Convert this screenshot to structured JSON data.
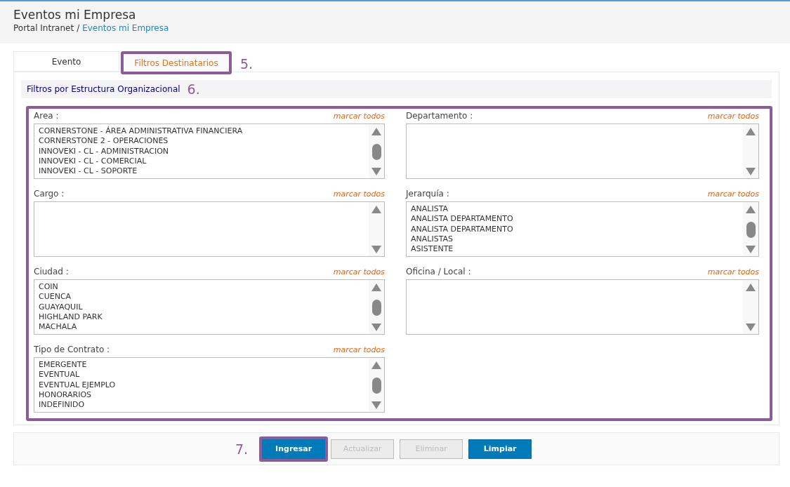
{
  "header": {
    "title": "Eventos mi Empresa",
    "breadcrumb_separator": "/",
    "breadcrumb": [
      {
        "label": "Portal Intranet",
        "current": false
      },
      {
        "label": "Eventos mi Empresa",
        "current": true
      }
    ]
  },
  "tabs": [
    {
      "label": "Evento",
      "selected": false,
      "highlighted": false
    },
    {
      "label": "Filtros Destinatarios",
      "selected": true,
      "highlighted": true
    }
  ],
  "tabs_annotation": "5.",
  "section": {
    "title": "Filtros por Estructura Organizacional",
    "annotation": "6.",
    "highlighted": true
  },
  "filters": [
    {
      "label": "Area :",
      "link": "marcar todos",
      "items": [
        "CORNERSTONE - ÁREA ADMINISTRATIVA FINANCIERA",
        "CORNERSTONE 2 - OPERACIONES",
        "INNOVEKI - CL - ADMINISTRACION",
        "INNOVEKI - CL - COMERCIAL",
        "INNOVEKI - CL - SOPORTE"
      ]
    },
    {
      "label": "Departamento :",
      "link": "marcar todos"
    },
    {
      "label": "Cargo :",
      "link": "marcar todos"
    },
    {
      "label": "Jerarquía :",
      "link": "marcar todos",
      "items": [
        "ANALISTA",
        "ANALISTA DEPARTAMENTO",
        "ANALISTA DEPARTAMENTO",
        "ANALISTAS",
        "ASISTENTE"
      ]
    },
    {
      "label": "Ciudad :",
      "link": "marcar todos",
      "items": [
        "COIN",
        "CUENCA",
        "GUAYAQUIL",
        "HIGHLAND PARK",
        "MACHALA"
      ]
    },
    {
      "label": "Oficina / Local :",
      "link": "marcar todos"
    },
    {
      "label": "Tipo de Contrato :",
      "link": "marcar todos",
      "items": [
        "EMERGENTE",
        "EVENTUAL",
        "EVENTUAL EJEMPLO",
        "HONORARIOS",
        "INDEFINIDO"
      ]
    }
  ],
  "buttons_annotation": "7.",
  "buttons": [
    {
      "label": "Ingresar",
      "disabled": false,
      "highlighted": true
    },
    {
      "label": "Actualizar",
      "disabled": true,
      "highlighted": false
    },
    {
      "label": "Eliminar",
      "disabled": true,
      "highlighted": false
    },
    {
      "label": "Limpiar",
      "disabled": false,
      "highlighted": false
    }
  ]
}
